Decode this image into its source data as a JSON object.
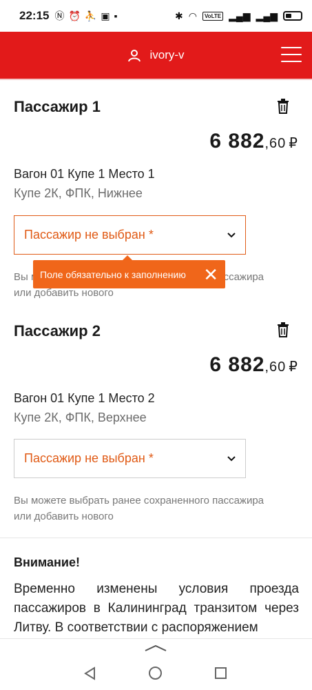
{
  "status_bar": {
    "time": "22:15",
    "left_icons": [
      "nfc-icon",
      "alarm-icon",
      "app-icon",
      "app-icon",
      "flag-icon"
    ],
    "right_icons": [
      "bluetooth-icon",
      "wifi-icon",
      "volte-icon",
      "signal-icon",
      "signal-icon",
      "battery-icon"
    ],
    "volte_label": "VoLTE"
  },
  "header": {
    "username": "ivory-v",
    "brand_color": "#e21a1a"
  },
  "passengers": [
    {
      "title": "Пассажир 1",
      "price_main": "6 882",
      "price_kop": ",60",
      "currency": "₽",
      "seat": "Вагон 01 Купе 1 Место 1",
      "details": "Купе 2К, ФПК, Нижнее",
      "select_placeholder": "Пассажир не выбран",
      "required_mark": "*",
      "hint_line1": "Вы можете выбрать ранее сохраненного пассажира",
      "hint_line2": "или добавить нового"
    },
    {
      "title": "Пассажир 2",
      "price_main": "6 882",
      "price_kop": ",60",
      "currency": "₽",
      "seat": "Вагон 01 Купе 1 Место 2",
      "details": "Купе 2К, ФПК, Верхнее",
      "select_placeholder": "Пассажир не выбран",
      "required_mark": "*",
      "hint_line1": "Вы можете выбрать ранее сохраненного пассажира",
      "hint_line2": "или добавить нового"
    }
  ],
  "tooltip": {
    "text": "Поле обязательно к заполнению",
    "color": "#f0661a"
  },
  "attention": {
    "title": "Внимание!",
    "text": "Временно изменены условия проезда пассажиров в Калининград транзитом через Литву. В соответствии с распоряжением"
  },
  "colors": {
    "accent_orange": "#e05a15"
  }
}
